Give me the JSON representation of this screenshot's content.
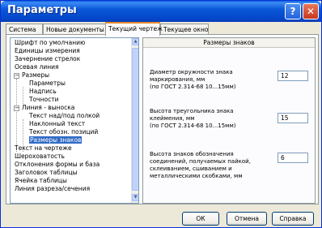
{
  "window": {
    "title": "Параметры"
  },
  "title_buttons": {
    "help": "?",
    "close": "✕"
  },
  "tabs": [
    {
      "label": "Система"
    },
    {
      "label": "Новые документы"
    },
    {
      "label": "Текущий чертеж"
    },
    {
      "label": "Текущее окно"
    }
  ],
  "active_tab": "Текущий чертеж",
  "tree": {
    "items": [
      {
        "label": "Шрифт по умолчанию"
      },
      {
        "label": "Единицы измерения"
      },
      {
        "label": "Зачернение стрелок"
      },
      {
        "label": "Осевая линия"
      },
      {
        "label": "Размеры",
        "expander": "−"
      },
      {
        "label": "Параметры"
      },
      {
        "label": "Надпись"
      },
      {
        "label": "Точности"
      },
      {
        "label": "Линия - выноска",
        "expander": "−"
      },
      {
        "label": "Текст над/под полкой"
      },
      {
        "label": "Наклонный текст"
      },
      {
        "label": "Текст обозн. позиций"
      },
      {
        "label": "Размеры знаков",
        "selected": true
      },
      {
        "label": "Текст на чертеже"
      },
      {
        "label": "Шероховатость"
      },
      {
        "label": "Отклонения формы и база"
      },
      {
        "label": "Заголовок таблицы"
      },
      {
        "label": "Ячейка таблицы"
      },
      {
        "label": "Линия разреза/сечения"
      }
    ],
    "scroll_up_arrow": "▲",
    "scroll_down_arrow": "▼"
  },
  "panel": {
    "header": "Размеры знаков",
    "fields": [
      {
        "label_lines": [
          "Диаметр окружности знака",
          "маркирования, мм",
          "(по ГОСТ 2.314-68 10...15мм)"
        ],
        "value": "12"
      },
      {
        "label_lines": [
          "Высота треугольника знака",
          "клеймения, мм",
          "(по ГОСТ 2.314-68 10...15мм)"
        ],
        "value": "15"
      },
      {
        "label_lines": [
          "Высота знаков обозначения",
          "соединений, получаемых пайкой,",
          "склеиванием, сшиванием и",
          "металлическими скобками, мм"
        ],
        "value": "6"
      }
    ]
  },
  "buttons": {
    "ok": "ОК",
    "cancel": "Отмена",
    "help": "Справка"
  }
}
